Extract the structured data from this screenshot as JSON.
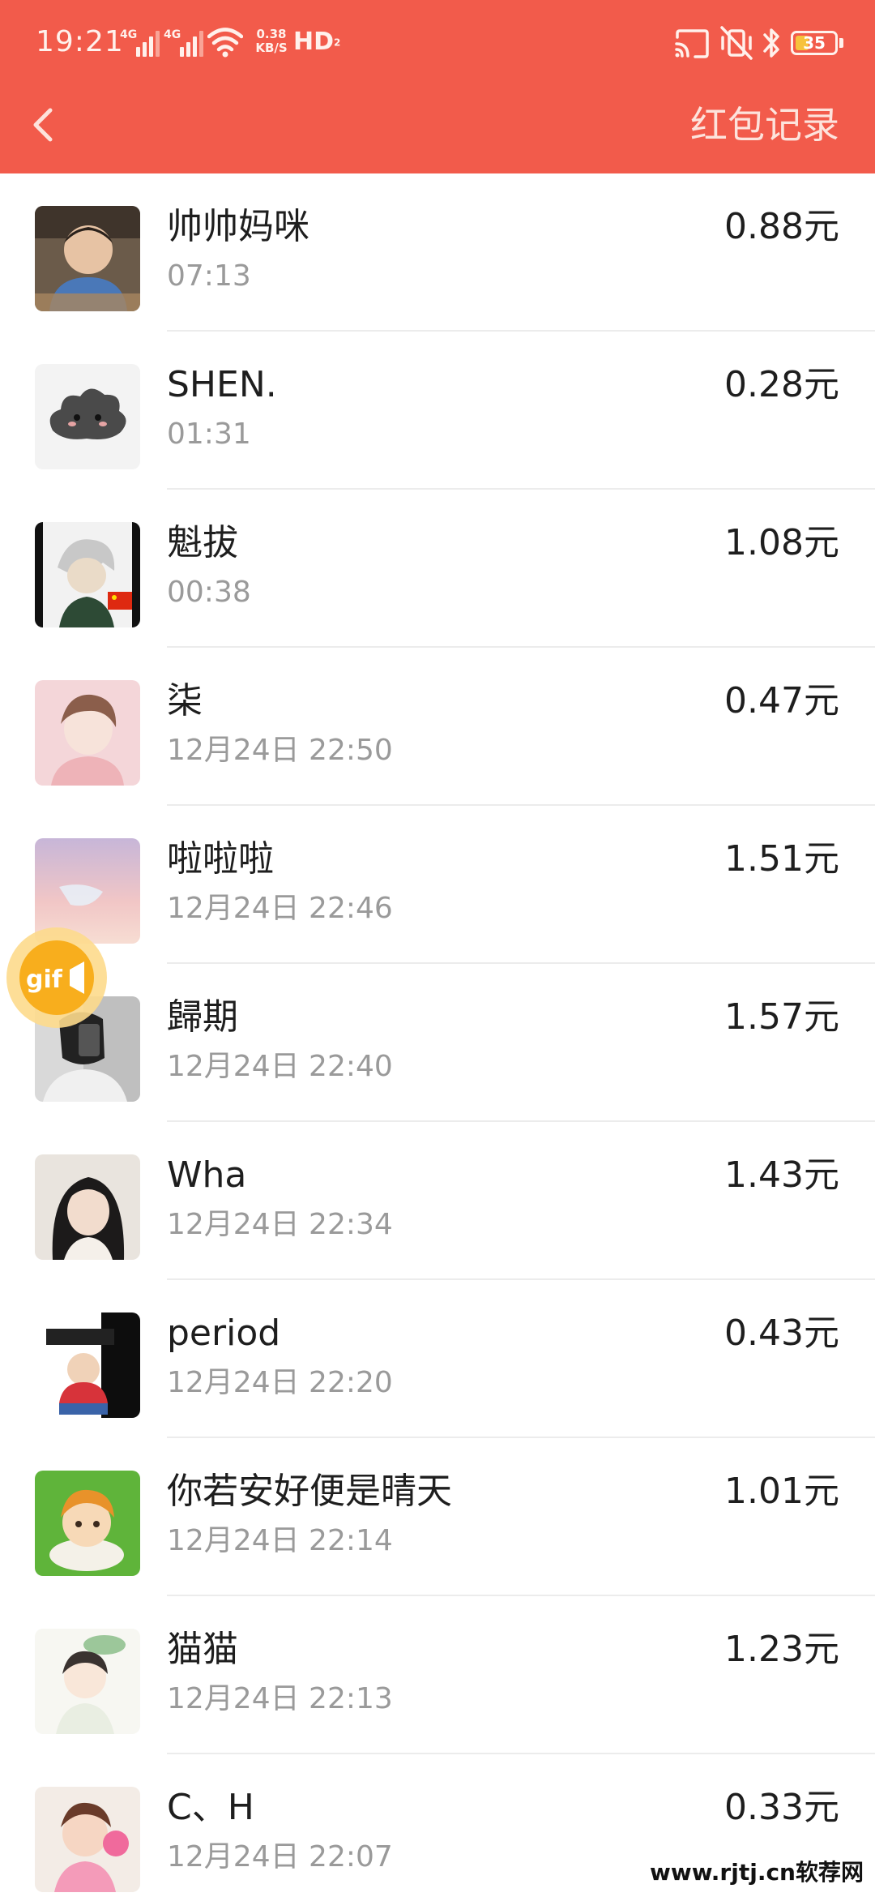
{
  "status_bar": {
    "time": "19:21",
    "sim1_network": "4G",
    "sim2_network": "4G",
    "net_speed_value": "0.38",
    "net_speed_unit": "KB/S",
    "hd_label": "HD",
    "hd_sub": "2",
    "battery_level": "35",
    "icons": [
      "signal-icon",
      "wifi-icon",
      "cast-icon",
      "vibrate-mute-icon",
      "bluetooth-icon",
      "battery-icon"
    ]
  },
  "title_bar": {
    "back_icon": "chevron-left-icon",
    "records_label": "红包记录"
  },
  "records": [
    {
      "name": "帅帅妈咪",
      "time": "07:13",
      "amount": "0.88元"
    },
    {
      "name": "SHEN.",
      "time": "01:31",
      "amount": "0.28元"
    },
    {
      "name": "魁拔",
      "time": "00:38",
      "amount": "1.08元"
    },
    {
      "name": "柒",
      "time": "12月24日  22:50",
      "amount": "0.47元"
    },
    {
      "name": "啦啦啦",
      "time": "12月24日  22:46",
      "amount": "1.51元"
    },
    {
      "name": "歸期",
      "time": "12月24日  22:40",
      "amount": "1.57元"
    },
    {
      "name": "Wha",
      "time": "12月24日  22:34",
      "amount": "1.43元"
    },
    {
      "name": "period",
      "time": "12月24日  22:20",
      "amount": "0.43元"
    },
    {
      "name": "你若安好便是晴天",
      "time": "12月24日  22:14",
      "amount": "1.01元"
    },
    {
      "name": "猫猫",
      "time": "12月24日  22:13",
      "amount": "1.23元"
    },
    {
      "name": "C、H",
      "time": "12月24日  22:07",
      "amount": "0.33元"
    }
  ],
  "floating_button": {
    "label": "gif",
    "icon": "video-camera-icon"
  },
  "watermark": "www.rjtj.cn软荐网",
  "colors": {
    "header_bg": "#f25b4b",
    "header_text": "#fde3dc",
    "name_text": "#1e1e1e",
    "time_text": "#9a9a9a",
    "divider": "#ececec",
    "gif_button": "#f8ae1d",
    "battery_fill": "#f7c23c"
  }
}
